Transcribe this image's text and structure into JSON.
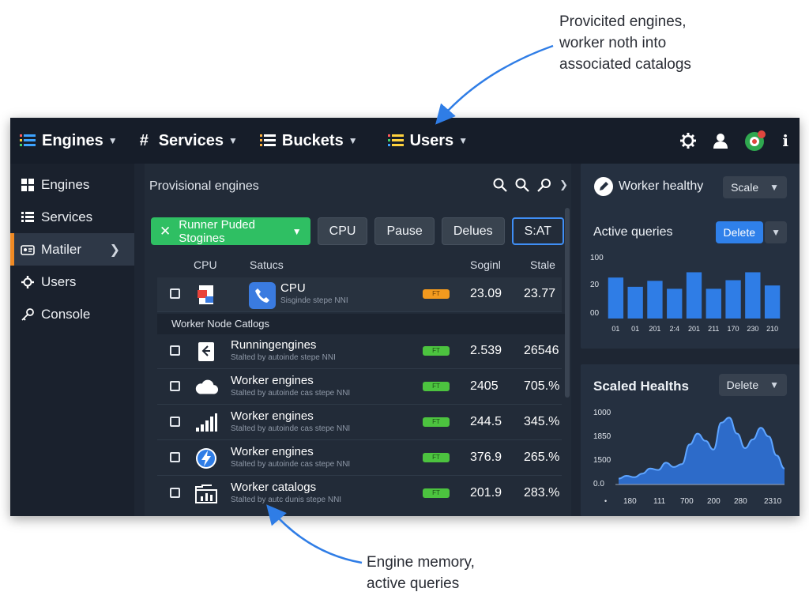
{
  "annotations": {
    "top_lines": [
      "Provicited engines,",
      "worker noth into",
      "associated catalogs"
    ],
    "bottom_lines": [
      "Engine memory,",
      "active queries"
    ]
  },
  "topnav": [
    {
      "label": "Engines",
      "icon": "list-icon"
    },
    {
      "label": "Services",
      "icon": "hash-icon"
    },
    {
      "label": "Buckets",
      "icon": "list-icon"
    },
    {
      "label": "Users",
      "icon": "list-icon"
    }
  ],
  "topbar_icons": [
    "gear-icon",
    "user-icon",
    "status-avatar-icon",
    "info-icon"
  ],
  "sidebar": {
    "items": [
      {
        "label": "Engines",
        "icon": "grid-icon"
      },
      {
        "label": "Services",
        "icon": "list-icon"
      },
      {
        "label": "Matiler",
        "icon": "tag-icon",
        "active": true
      },
      {
        "label": "Users",
        "icon": "gear-icon"
      },
      {
        "label": "Console",
        "icon": "key-icon"
      }
    ]
  },
  "main": {
    "title": "Provisional engines",
    "buttons": {
      "primary": "Runner Puded Stogines",
      "cpu": "CPU",
      "pause": "Pause",
      "delues": "Delues",
      "stat": "S:AT"
    },
    "columns": {
      "col1": "CPU",
      "col2": "Satucs",
      "col3": "Soginl",
      "col4": "Stale"
    },
    "first_row": {
      "name": "CPU",
      "sub": "Sisginde stepe NNI",
      "badge": "FT",
      "v1": "23.09",
      "v2": "23.77"
    },
    "section_label": "Worker Node Catlogs",
    "rows": [
      {
        "name": "Runningengines",
        "sub": "Stalted by autoinde stepe NNI",
        "badge": "FT",
        "v1": "2.539",
        "v2": "26546"
      },
      {
        "name": "Worker engines",
        "sub": "Stalted by autoinde cas stepe NNI",
        "badge": "FT",
        "v1": "2405",
        "v2": "705.%"
      },
      {
        "name": "Worker engines",
        "sub": "Stalted by autoinde cas stepe NNI",
        "badge": "FT",
        "v1": "244.5",
        "v2": "345.%"
      },
      {
        "name": "Worker engines",
        "sub": "Stalted by autoinde cas stepe NNI",
        "badge": "FT",
        "v1": "376.9",
        "v2": "265.%"
      },
      {
        "name": "Worker catalogs",
        "sub": "Stalted by autc dunis stepe NNI",
        "badge": "FT",
        "v1": "201.9",
        "v2": "283.%"
      }
    ]
  },
  "right_top": {
    "health_label": "Worker healthy",
    "scale_label": "Scale",
    "title": "Active queries",
    "delete_label": "Delete"
  },
  "right_bottom": {
    "title": "Scaled Healths",
    "delete_label": "Delete"
  },
  "colors": {
    "accent_green": "#2fbf63",
    "accent_blue": "#3f8ef5",
    "bar_blue": "#2f7de6",
    "orange": "#f08a24"
  },
  "chart_data": [
    {
      "type": "bar",
      "title": "Active queries",
      "y_ticks": [
        "100",
        "20",
        "00"
      ],
      "categories": [
        "01",
        "01",
        "201",
        "2:4",
        "201",
        "211",
        "170",
        "230",
        "210"
      ],
      "values": [
        62,
        48,
        57,
        45,
        70,
        45,
        58,
        70,
        50
      ],
      "ylim": [
        0,
        100
      ]
    },
    {
      "type": "area",
      "title": "Scaled Healths",
      "y_ticks": [
        "1000",
        "1850",
        "1500",
        "0.0"
      ],
      "x_ticks": [
        "180",
        "111",
        "700",
        "200",
        "280",
        "2310"
      ],
      "values": [
        8,
        12,
        10,
        15,
        22,
        20,
        30,
        24,
        28,
        55,
        70,
        60,
        48,
        85,
        92,
        70,
        50,
        62,
        78,
        66,
        40,
        22
      ]
    }
  ]
}
